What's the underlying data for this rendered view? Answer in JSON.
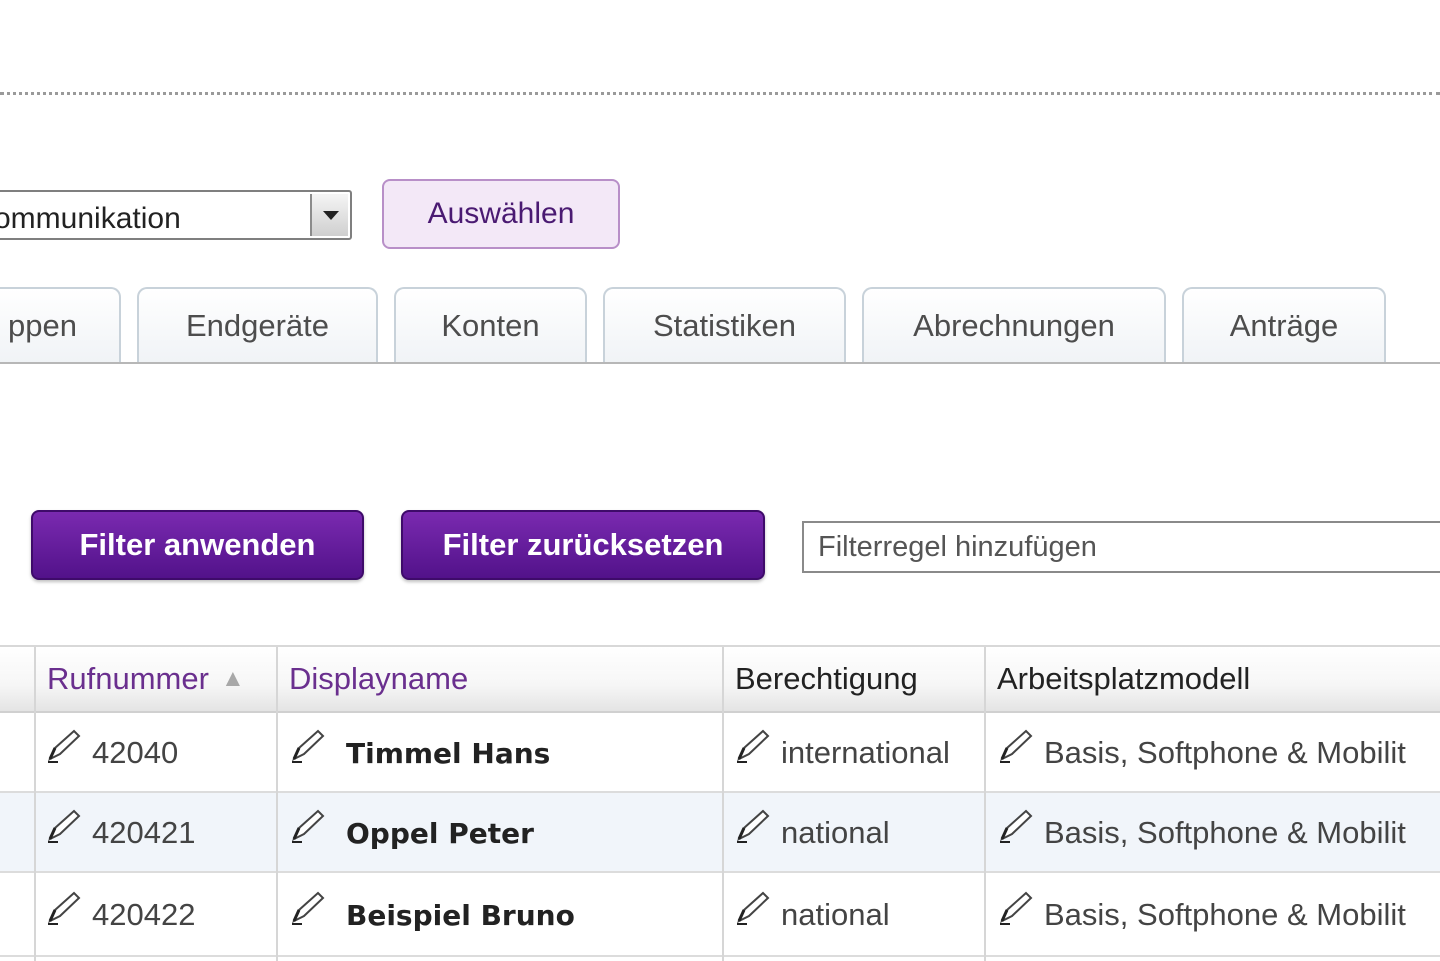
{
  "selector": {
    "value": "ommunikation",
    "button_label": "Auswählen"
  },
  "tabs": [
    {
      "label": "ppen"
    },
    {
      "label": "Endgeräte"
    },
    {
      "label": "Konten"
    },
    {
      "label": "Statistiken"
    },
    {
      "label": "Abrechnungen"
    },
    {
      "label": "Anträge"
    }
  ],
  "filter": {
    "apply_label": "Filter anwenden",
    "reset_label": "Filter zurücksetzen",
    "rule_placeholder": "Filterregel hinzufügen"
  },
  "table": {
    "columns": {
      "rufnummer": "Rufnummer",
      "displayname": "Displayname",
      "berechtigung": "Berechtigung",
      "arbeitsplatzmodell": "Arbeitsplatzmodell"
    },
    "sort_indicator": "▲",
    "rows": [
      {
        "rufnummer": "42040",
        "displayname": "Timmel Hans",
        "berechtigung": "international",
        "arbeitsplatzmodell": "Basis, Softphone & Mobilit"
      },
      {
        "rufnummer": "420421",
        "displayname": "Oppel Peter",
        "berechtigung": "national",
        "arbeitsplatzmodell": "Basis, Softphone & Mobilit"
      },
      {
        "rufnummer": "420422",
        "displayname": "Beispiel Bruno",
        "berechtigung": "national",
        "arbeitsplatzmodell": "Basis, Softphone & Mobilit"
      }
    ]
  },
  "colors": {
    "primary_purple": "#5a1591",
    "link_purple": "#6a2f8e",
    "tab_border": "#c8d2da",
    "alt_row": "#f1f5fa"
  },
  "icons": {
    "edit": "pencil-icon",
    "dropdown": "chevron-down-icon"
  }
}
